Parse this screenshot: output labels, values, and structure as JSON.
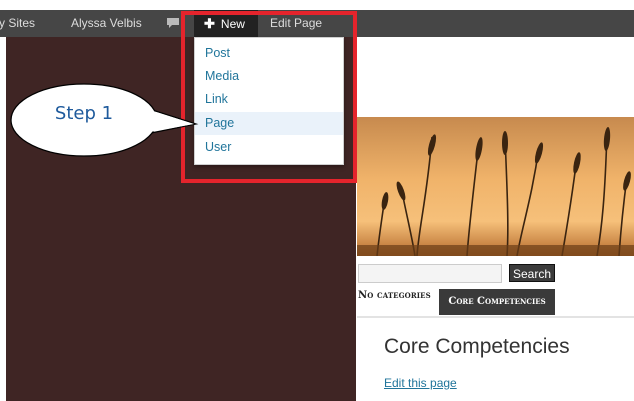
{
  "admin_bar": {
    "my_sites": "My Sites",
    "user_name": "Alyssa Velbis",
    "new_label": "New",
    "new_icon": "plus-icon",
    "edit_page": "Edit Page",
    "comment_icon": "comment-bubble-icon",
    "background_color": "#464646"
  },
  "new_menu": {
    "items": [
      {
        "label": "Post"
      },
      {
        "label": "Media"
      },
      {
        "label": "Link"
      },
      {
        "label": "Page",
        "highlighted": true
      },
      {
        "label": "User"
      }
    ],
    "link_color": "#21759b"
  },
  "annotation": {
    "callout_text": "Step 1",
    "highlight_color": "#e5242c"
  },
  "site": {
    "search_button": "Search",
    "search_value": "",
    "no_categories": "No categories",
    "nav_tab": "Core Competencies",
    "page_title": "Core Competencies",
    "edit_link": "Edit this page",
    "left_panel_color": "#3f2524"
  }
}
